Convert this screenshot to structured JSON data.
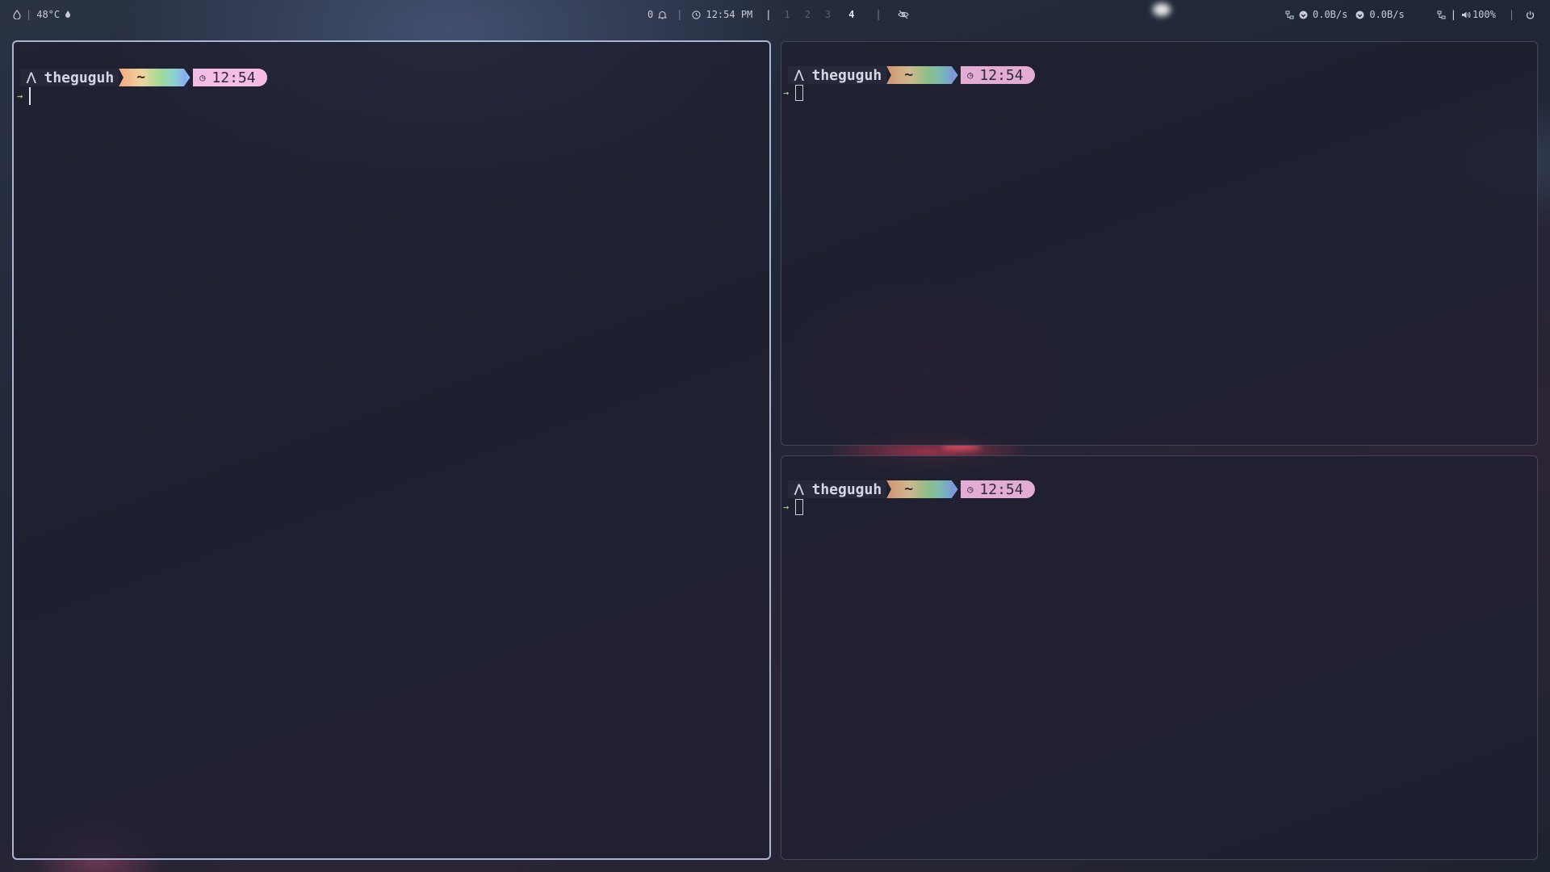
{
  "topbar": {
    "left": {
      "icon": "droplet-icon",
      "temperature": "48°C",
      "temp_icon": "flame-icon"
    },
    "center": {
      "notification_count": "0",
      "notification_icon": "bell-icon",
      "clock_icon": "clock-icon",
      "time": "12:54 PM",
      "workspaces": [
        "1",
        "2",
        "3",
        "4"
      ],
      "active_workspace": "4",
      "privacy_icon": "eye-slash-icon"
    },
    "right": {
      "net_icon": "network-icon",
      "upload": "0.0B/s",
      "download": "0.0B/s",
      "upload_icon": "upload-icon",
      "download_icon": "download-icon",
      "net2_icon": "network-icon",
      "volume_icon": "speaker-icon",
      "volume": "100%",
      "power_icon": "power-icon"
    }
  },
  "terminals": [
    {
      "user": "theguguh",
      "dir": "~",
      "time": "12:54",
      "user_icon": "arch-icon",
      "clock_icon": "clock-icon",
      "line_arrow": "→",
      "focused": true
    },
    {
      "user": "theguguh",
      "dir": "~",
      "time": "12:54",
      "user_icon": "arch-icon",
      "clock_icon": "clock-icon",
      "line_arrow": "→",
      "focused": false
    },
    {
      "user": "theguguh",
      "dir": "~",
      "time": "12:54",
      "user_icon": "arch-icon",
      "clock_icon": "clock-icon",
      "line_arrow": "→",
      "focused": false
    }
  ],
  "colors": {
    "focused_border": "#a9b4d6",
    "time_segment": "#f5bde6",
    "prompt_arrow": "#a6da95"
  }
}
